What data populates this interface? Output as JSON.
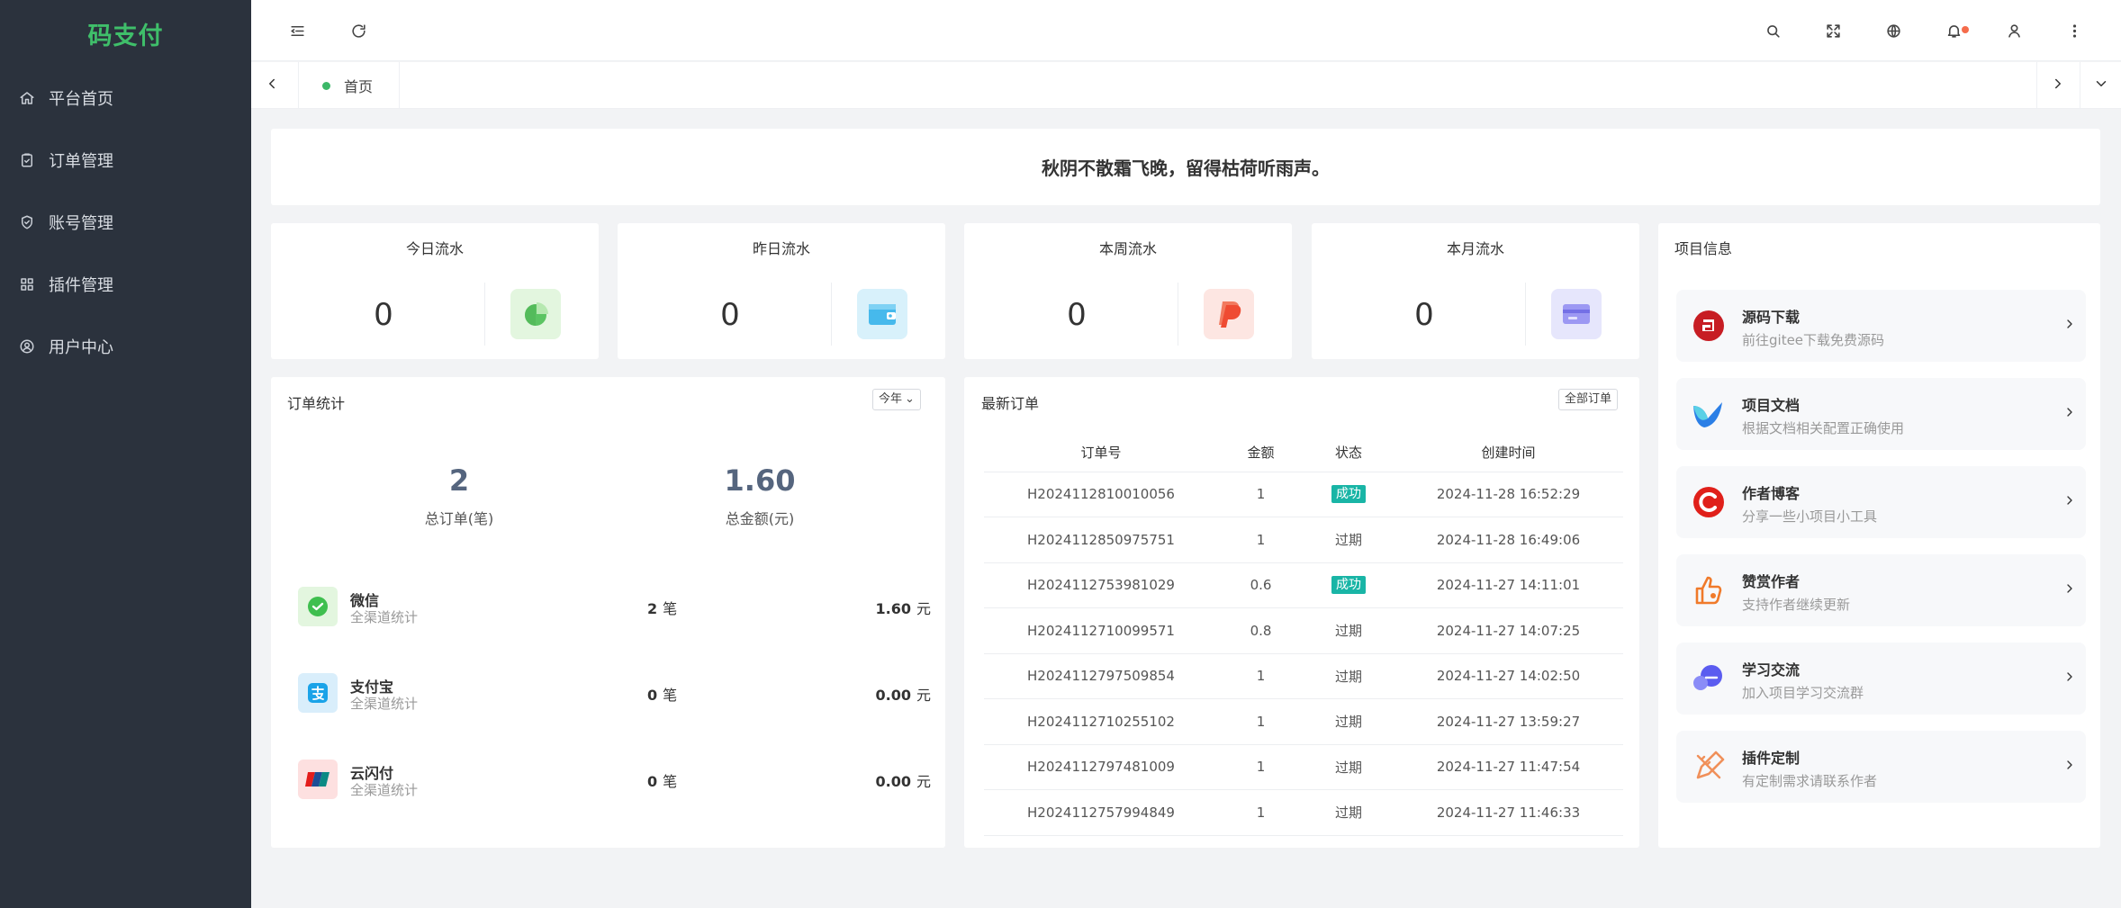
{
  "app": {
    "logo": "码支付"
  },
  "sidebar": {
    "items": [
      {
        "label": "平台首页",
        "icon": "home-icon"
      },
      {
        "label": "订单管理",
        "icon": "clipboard-check-icon"
      },
      {
        "label": "账号管理",
        "icon": "shield-check-icon"
      },
      {
        "label": "插件管理",
        "icon": "grid-icon"
      },
      {
        "label": "用户中心",
        "icon": "user-circle-icon"
      }
    ]
  },
  "header": {
    "icons": [
      "menu-fold-icon",
      "refresh-icon",
      "search-icon",
      "fullscreen-icon",
      "globe-icon",
      "bell-icon",
      "user-icon",
      "more-vertical-icon"
    ],
    "notification_color": "#f56c4b"
  },
  "tabs": {
    "home": "首页"
  },
  "banner": {
    "text": "秋阴不散霜飞晚，留得枯荷听雨声。"
  },
  "stats": [
    {
      "title": "今日流水",
      "value": "0",
      "icon": "pie-chart-icon",
      "color": "#4cc45f"
    },
    {
      "title": "昨日流水",
      "value": "0",
      "icon": "wallet-icon",
      "color": "#3cb6e8"
    },
    {
      "title": "本周流水",
      "value": "0",
      "icon": "paypal-icon",
      "color": "#f0593e"
    },
    {
      "title": "本月流水",
      "value": "0",
      "icon": "card-icon",
      "color": "#8a85f0"
    }
  ],
  "order_stats": {
    "title": "订单统计",
    "period": "今年",
    "total_orders": "2",
    "total_orders_label": "总订单(笔)",
    "total_amount": "1.60",
    "total_amount_label": "总金额(元)",
    "channels": [
      {
        "name": "微信",
        "sub": "全渠道统计",
        "count": "2",
        "count_unit": "笔",
        "amount": "1.60",
        "amount_unit": "元",
        "icon": "wechat-icon"
      },
      {
        "name": "支付宝",
        "sub": "全渠道统计",
        "count": "0",
        "count_unit": "笔",
        "amount": "0.00",
        "amount_unit": "元",
        "icon": "alipay-icon"
      },
      {
        "name": "云闪付",
        "sub": "全渠道统计",
        "count": "0",
        "count_unit": "笔",
        "amount": "0.00",
        "amount_unit": "元",
        "icon": "unionpay-icon"
      }
    ]
  },
  "latest_orders": {
    "title": "最新订单",
    "all_button": "全部订单",
    "columns": [
      "订单号",
      "金额",
      "状态",
      "创建时间"
    ],
    "rows": [
      {
        "id": "H2024112810010056",
        "amount": "1",
        "status": "成功",
        "ok": true,
        "time": "2024-11-28 16:52:29"
      },
      {
        "id": "H2024112850975751",
        "amount": "1",
        "status": "过期",
        "ok": false,
        "time": "2024-11-28 16:49:06"
      },
      {
        "id": "H2024112753981029",
        "amount": "0.6",
        "status": "成功",
        "ok": true,
        "time": "2024-11-27 14:11:01"
      },
      {
        "id": "H2024112710099571",
        "amount": "0.8",
        "status": "过期",
        "ok": false,
        "time": "2024-11-27 14:07:25"
      },
      {
        "id": "H2024112797509854",
        "amount": "1",
        "status": "过期",
        "ok": false,
        "time": "2024-11-27 14:02:50"
      },
      {
        "id": "H2024112710255102",
        "amount": "1",
        "status": "过期",
        "ok": false,
        "time": "2024-11-27 13:59:27"
      },
      {
        "id": "H2024112797481009",
        "amount": "1",
        "status": "过期",
        "ok": false,
        "time": "2024-11-27 11:47:54"
      },
      {
        "id": "H2024112757994849",
        "amount": "1",
        "status": "过期",
        "ok": false,
        "time": "2024-11-27 11:46:33"
      }
    ]
  },
  "project_info": {
    "title": "项目信息",
    "items": [
      {
        "title": "源码下载",
        "desc": "前往gitee下载免费源码",
        "icon": "gitee-icon",
        "color": "#c71d23"
      },
      {
        "title": "项目文档",
        "desc": "根据文档相关配置正确使用",
        "icon": "document-bird-icon",
        "color": "#2b7fe6"
      },
      {
        "title": "作者博客",
        "desc": "分享一些小项目小工具",
        "icon": "csdn-icon",
        "color": "#e0201a"
      },
      {
        "title": "赞赏作者",
        "desc": "支持作者继续更新",
        "icon": "thumbs-up-icon",
        "color": "#f07a2a"
      },
      {
        "title": "学习交流",
        "desc": "加入项目学习交流群",
        "icon": "chat-group-icon",
        "color": "#5b5cf0"
      },
      {
        "title": "插件定制",
        "desc": "有定制需求请联系作者",
        "icon": "pencil-ruler-icon",
        "color": "#f0905a"
      }
    ]
  }
}
